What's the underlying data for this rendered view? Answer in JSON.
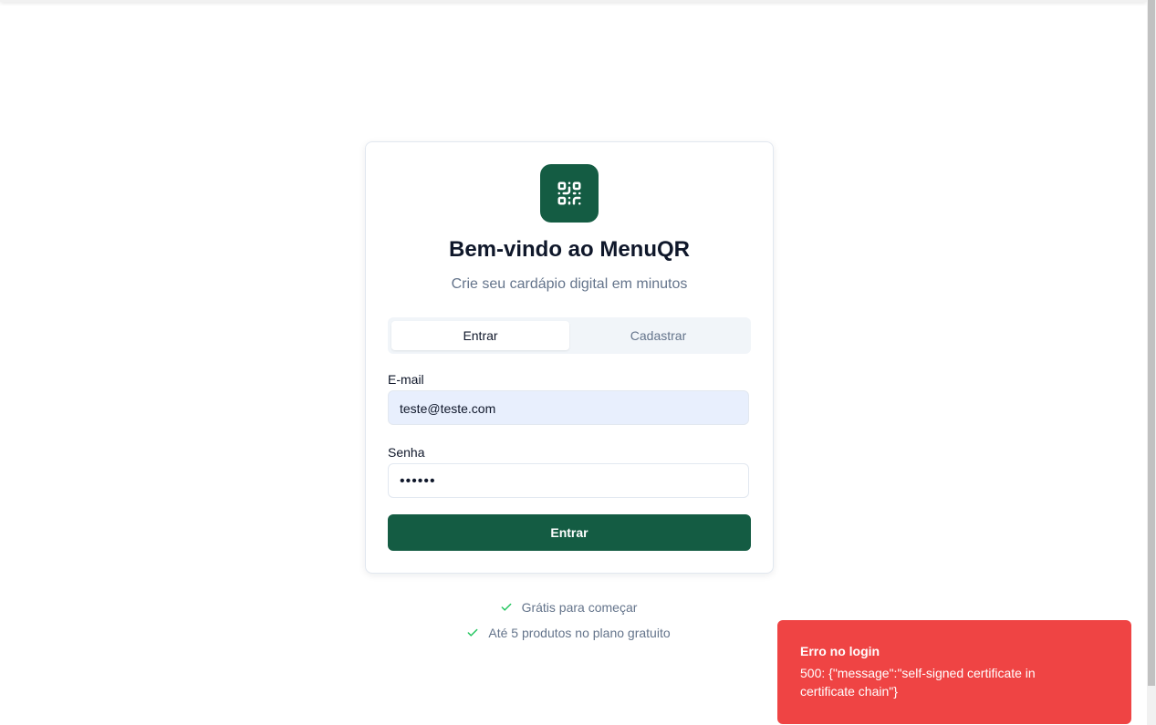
{
  "app": {
    "title": "Bem-vindo ao MenuQR",
    "subtitle": "Crie seu cardápio digital em minutos",
    "logo_icon": "qr-code-icon",
    "brand_color": "#145c43"
  },
  "tabs": [
    {
      "label": "Entrar",
      "active": true
    },
    {
      "label": "Cadastrar",
      "active": false
    }
  ],
  "form": {
    "email_label": "E-mail",
    "email_value": "teste@teste.com",
    "password_label": "Senha",
    "password_value": "••••••",
    "submit_label": "Entrar"
  },
  "features": [
    {
      "icon": "check-icon",
      "text": "Grátis para começar"
    },
    {
      "icon": "check-icon",
      "text": "Até 5 produtos no plano gratuito"
    }
  ],
  "toast": {
    "title": "Erro no login",
    "message": "500: {\"message\":\"self-signed certificate in certificate chain\"}",
    "color": "#ef4444"
  }
}
